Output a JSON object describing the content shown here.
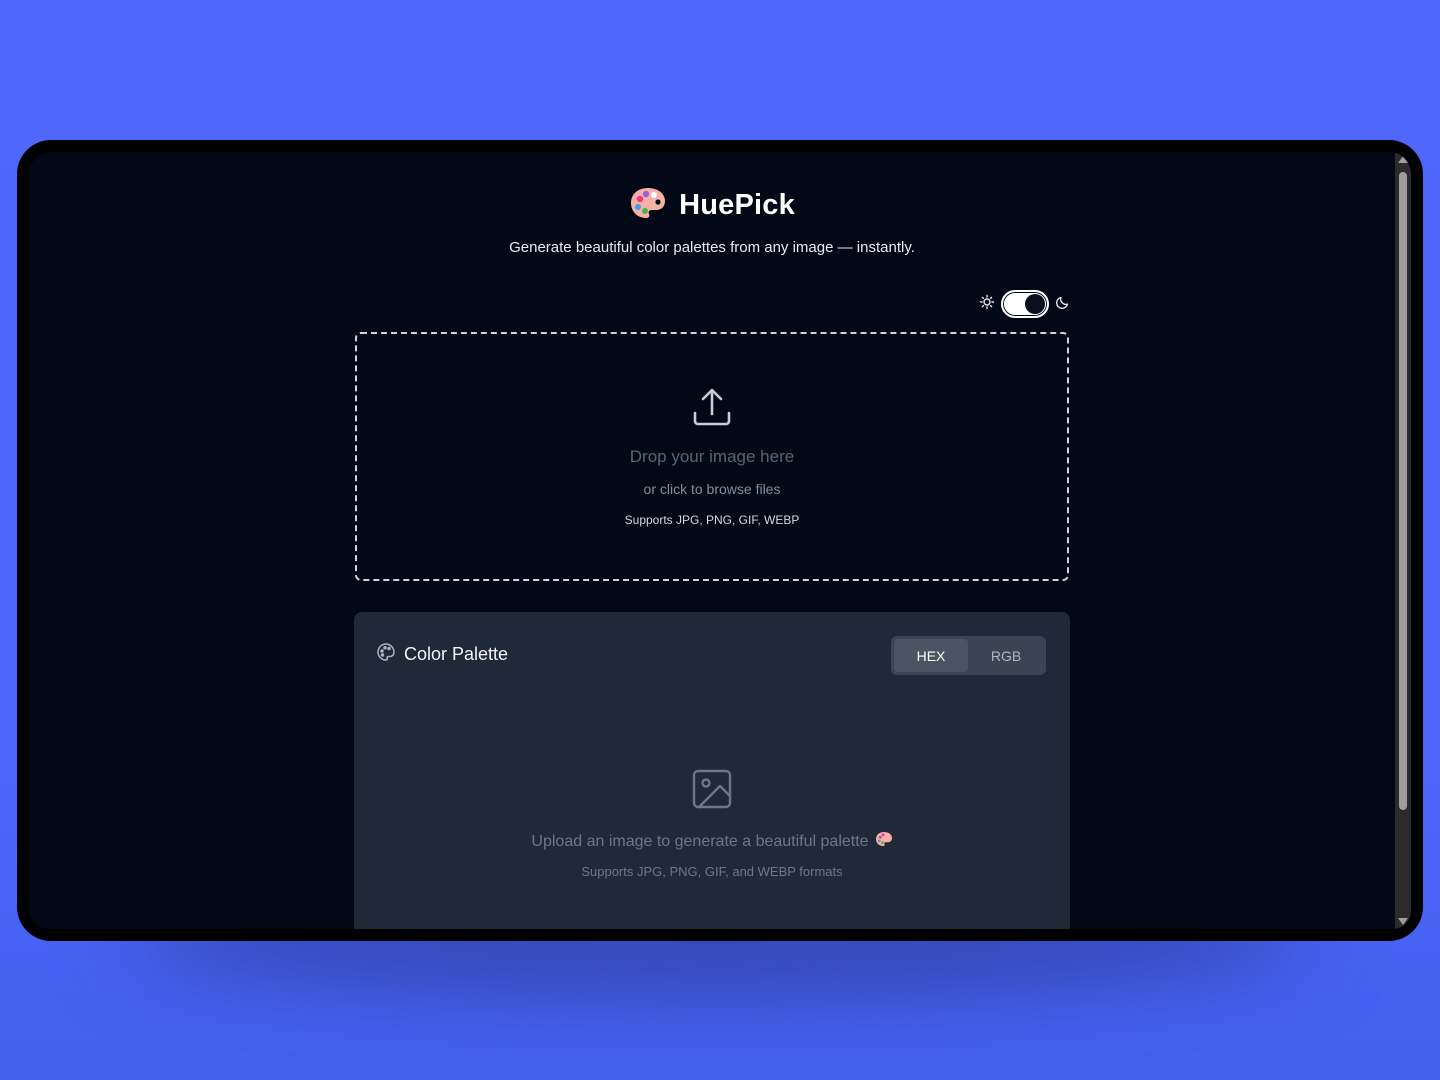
{
  "app": {
    "title": "HuePick",
    "tagline": "Generate beautiful color palettes from any image — instantly.",
    "logo_icon": "palette-icon"
  },
  "theme_toggle": {
    "state": "dark",
    "light_icon": "sun-icon",
    "dark_icon": "moon-icon"
  },
  "dropzone": {
    "icon": "upload-icon",
    "title": "Drop your image here",
    "subtitle": "or click to browse files",
    "formats": "Supports JPG, PNG, GIF, WEBP"
  },
  "palette": {
    "title": "Color Palette",
    "icon": "palette-outline-icon",
    "formats": [
      {
        "label": "HEX",
        "selected": true
      },
      {
        "label": "RGB",
        "selected": false
      }
    ],
    "empty_state": {
      "icon": "image-icon",
      "title": "Upload an image to generate a beautiful palette",
      "subtitle": "Supports JPG, PNG, GIF, and WEBP formats"
    }
  },
  "colors": {
    "page_background": "#4f67fb",
    "screen_background": "#020816",
    "card_background": "#1f2937",
    "accent_text": "#ffffff"
  }
}
